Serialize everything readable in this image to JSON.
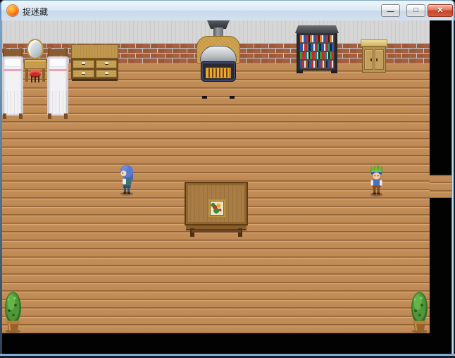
{
  "window": {
    "title": "捉迷藏",
    "app_icon": "rpg-maker-orange-sphere-icon",
    "controls": {
      "minimize_glyph": "—",
      "maximize_glyph": "□",
      "close_glyph": "✕"
    }
  },
  "scene": {
    "description": "RPG Maker room interior with wooden plank floor, brick wainscot wall and gray upper wall, black letterbox on right and bottom, doorway corridor opening on right wall",
    "colors": {
      "floor": "#c28d58",
      "brick": "#9c5a38",
      "mortar": "#c3c9cd",
      "upper_wall": "#d6d6d6",
      "letterbox": "#000000",
      "titlebar_gradient_top": "#eef5fb",
      "close_button_red": "#c6452a"
    },
    "objects": [
      "bed-white-pink-trim-left",
      "vanity-with-oval-mirror-and-red-stool",
      "bed-white-pink-trim-right",
      "wooden-dresser-four-drawers",
      "wood-stove-with-chimney-pipe",
      "bookshelf-with-colorful-books",
      "small-tan-cabinet",
      "large-center-table",
      "framed-flower-picture-on-table",
      "potted-plant-bottom-left",
      "potted-plant-bottom-right"
    ],
    "characters": [
      {
        "id": "blue-haired-girl",
        "hair_color": "#5b7ad2",
        "outfit_color": "#3f6f80",
        "facing": "left"
      },
      {
        "id": "green-haired-boy",
        "hair_color": "#5aa832",
        "outfit_color": "#4a70c0",
        "facing": "down"
      }
    ]
  }
}
